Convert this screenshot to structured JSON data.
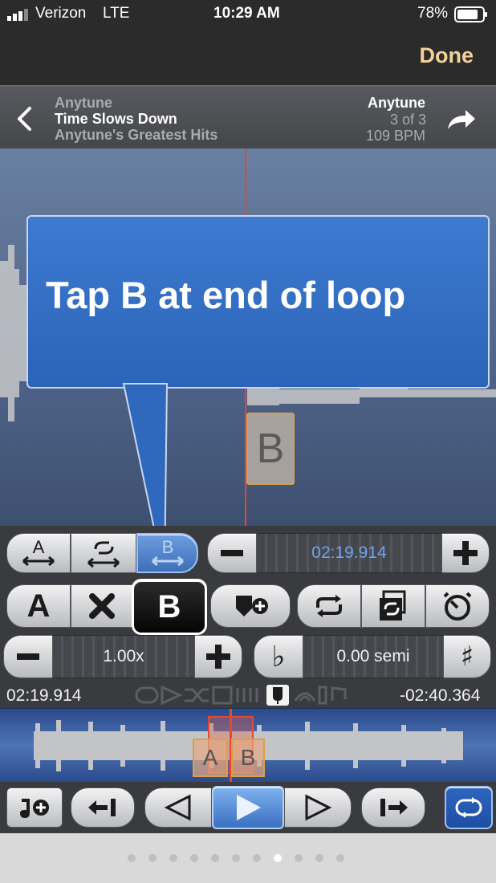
{
  "status": {
    "carrier": "Verizon",
    "network": "LTE",
    "time": "10:29 AM",
    "battery": "78%"
  },
  "nav": {
    "done_label": "Done"
  },
  "header": {
    "artist": "Anytune",
    "title": "Time Slows Down",
    "album": "Anytune's Greatest Hits",
    "right_title": "Anytune",
    "position": "3 of 3",
    "bpm": "109 BPM"
  },
  "tooltip": {
    "text": "Tap B at end of loop"
  },
  "waveform": {
    "marker_b": "B"
  },
  "controls": {
    "loop_position": "02:19.914",
    "label_a": "A",
    "label_b": "B",
    "speed_value": "1.00x",
    "pitch_value": "0.00 semi",
    "flat_symbol": "♭",
    "sharp_symbol": "♯"
  },
  "timeline": {
    "elapsed": "02:19.914",
    "remaining": "-02:40.364",
    "marker_a": "A",
    "marker_b": "B"
  },
  "pager": {
    "count": 11,
    "active_index": 7
  },
  "colors": {
    "accent": "#2b64b8",
    "done": "#f4d29a",
    "playhead": "#e1453c"
  }
}
